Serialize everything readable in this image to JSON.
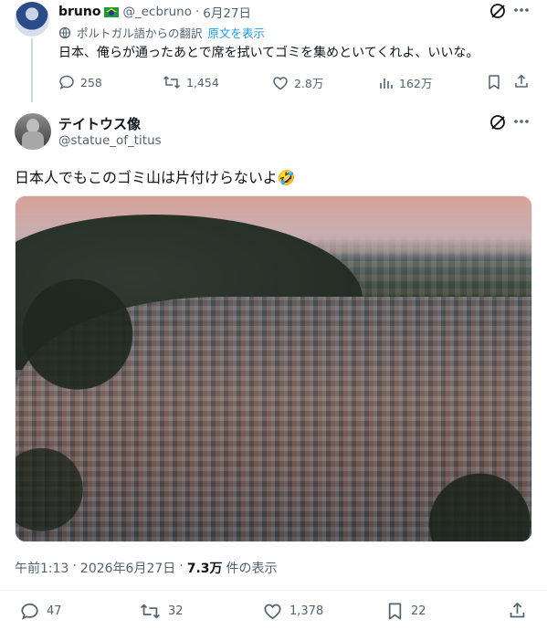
{
  "reply": {
    "name": "bruno",
    "handle": "@_ecbruno",
    "dot": "·",
    "date": "6月27日",
    "translation_note": "ポルトガル語からの翻訳",
    "show_original": "原文を表示",
    "text": "日本、俺らが通ったあとで席を拭いてゴミを集めといてくれよ、いいな。",
    "stats": {
      "replies": "258",
      "reposts": "1,454",
      "likes": "2.8万",
      "views": "162万"
    }
  },
  "tweet": {
    "name": "テイトウス像",
    "handle": "@statue_of_titus",
    "text": "日本人でもこのゴミ山は片付けらないよ🤣",
    "time": "午前1:13",
    "dot": "·",
    "date": "2026年6月27日",
    "dot2": "·",
    "views": "7.3万",
    "views_suffix": "件の表示",
    "stats": {
      "replies": "47",
      "reposts": "32",
      "likes": "1,378",
      "bookmarks": "22"
    }
  },
  "colors": {
    "link": "#1d9bf0",
    "muted": "#536471",
    "text": "#0f1419"
  }
}
